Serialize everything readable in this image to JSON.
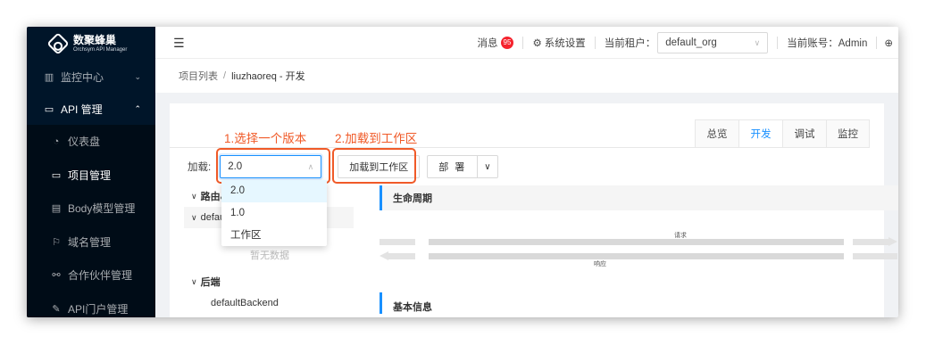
{
  "brand": {
    "name": "数聚蜂巢",
    "subtitle": "Orchsym API Manager"
  },
  "sidebar": {
    "items": [
      {
        "label": "监控中心",
        "icon": "chart-icon"
      },
      {
        "label": "API 管理",
        "icon": "folder-icon"
      }
    ],
    "submenu": [
      {
        "label": "仪表盘",
        "icon": "dashboard-icon"
      },
      {
        "label": "项目管理",
        "icon": "folder-icon"
      },
      {
        "label": "Body模型管理",
        "icon": "document-icon"
      },
      {
        "label": "域名管理",
        "icon": "flag-icon"
      },
      {
        "label": "合作伙伴管理",
        "icon": "partner-icon"
      },
      {
        "label": "API门户管理",
        "icon": "edit-icon"
      }
    ]
  },
  "header": {
    "messages_label": "消息",
    "messages_count": "95",
    "settings_label": "系统设置",
    "tenant_label": "当前租户：",
    "tenant_value": "default_org",
    "account_label": "当前账号：Admin"
  },
  "breadcrumb": {
    "parent": "项目列表",
    "separator": "/",
    "current": "liuzhaoreq - 开发"
  },
  "tabs": [
    "总览",
    "开发",
    "调试",
    "监控"
  ],
  "active_tab": "开发",
  "annotations": {
    "step1": "1.选择一个版本",
    "step2": "2.加载到工作区",
    "color": "#f05a28"
  },
  "load": {
    "label": "加载:",
    "selected_version": "2.0",
    "load_button": "加载到工作区",
    "deploy_button": "部 署",
    "options": [
      "2.0",
      "1.0",
      "工作区"
    ]
  },
  "tree": {
    "routes_header": "路由&/",
    "default_header": "default",
    "empty_text": "暂无数据",
    "backend_header": "后端",
    "backend_item": "defaultBackend"
  },
  "lifecycle": {
    "title": "生命周期",
    "request_label": "请求",
    "response_label": "响应",
    "next_title": "基本信息"
  },
  "colors": {
    "primary": "#1890ff",
    "sidebar_bg": "#001529",
    "badge": "#f5222d"
  }
}
